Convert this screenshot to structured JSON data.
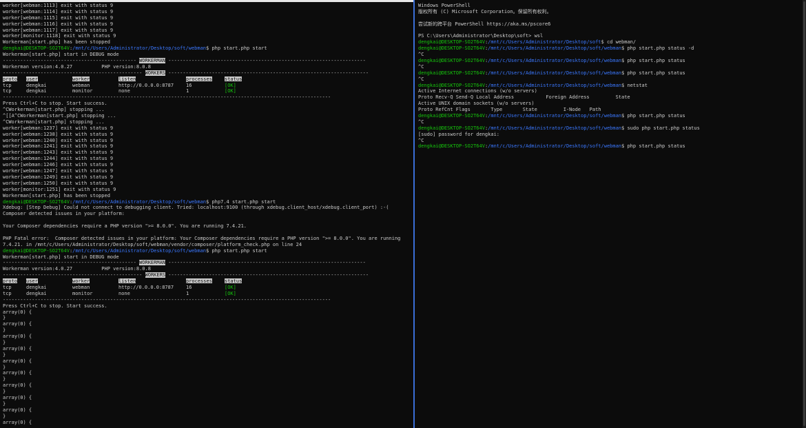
{
  "left": [
    {
      "t": "worker[webman:1113] exit with status 9"
    },
    {
      "t": "worker[webman:1114] exit with status 9"
    },
    {
      "t": "worker[webman:1115] exit with status 9"
    },
    {
      "t": "worker[webman:1116] exit with status 9"
    },
    {
      "t": "worker[webman:1117] exit with status 9"
    },
    {
      "t": "worker[monitor:1118] exit with status 9"
    },
    {
      "t": "Workerman[start.php] has been stopped"
    },
    {
      "prompt": {
        "user": "dengkai@DESKTOP-SO2T64V",
        "path": "/mnt/c/Users/Administrator/Desktop/soft/webman",
        "cmd": "$ php start.php start"
      }
    },
    {
      "t": "Workerman[start.php] start in DEBUG mode"
    },
    {
      "banner": {
        "pre": "---------------------------------------------- ",
        "label": "WORKERMAN",
        "post": " --------------------------------------------------------------------"
      }
    },
    {
      "t": "Workerman version:4.0.27          PHP version:8.0.8"
    },
    {
      "banner": {
        "pre": "------------------------------------------------ ",
        "label": "WORKERS",
        "post": " ---------------------------------------------------------------------"
      }
    },
    {
      "header": [
        "proto",
        "user",
        "worker",
        "listen",
        "processes",
        "status"
      ]
    },
    {
      "row": [
        "tcp",
        "dengkai",
        "webman",
        "http://0.0.0.0:8787",
        "16",
        "[OK]"
      ]
    },
    {
      "row": [
        "tcp",
        "dengkai",
        "monitor",
        "none",
        "1",
        "[OK]"
      ]
    },
    {
      "t": "-----------------------------------------------------------------------------------------------------------------"
    },
    {
      "t": "Press Ctrl+C to stop. Start success."
    },
    {
      "t": "^CWorkerman[start.php] stopping ..."
    },
    {
      "t": "^[[A^CWorkerman[start.php] stopping ..."
    },
    {
      "t": "^CWorkerman[start.php] stopping ..."
    },
    {
      "t": "worker[webman:1237] exit with status 9"
    },
    {
      "t": "worker[webman:1238] exit with status 9"
    },
    {
      "t": "worker[webman:1240] exit with status 9"
    },
    {
      "t": "worker[webman:1241] exit with status 9"
    },
    {
      "t": "worker[webman:1243] exit with status 9"
    },
    {
      "t": "worker[webman:1244] exit with status 9"
    },
    {
      "t": "worker[webman:1246] exit with status 9"
    },
    {
      "t": "worker[webman:1247] exit with status 9"
    },
    {
      "t": "worker[webman:1249] exit with status 9"
    },
    {
      "t": "worker[webman:1250] exit with status 9"
    },
    {
      "t": "worker[monitor:1251] exit with status 9"
    },
    {
      "t": "Workerman[start.php] has been stopped"
    },
    {
      "prompt": {
        "user": "dengkai@DESKTOP-SO2T64V",
        "path": "/mnt/c/Users/Administrator/Desktop/soft/webman",
        "cmd": "$ php7.4 start.php start"
      }
    },
    {
      "t": "Xdebug: [Step Debug] Could not connect to debugging client. Tried: localhost:9100 (through xdebug.client_host/xdebug.client_port) :-("
    },
    {
      "t": "Composer detected issues in your platform:"
    },
    {
      "t": ""
    },
    {
      "t": "Your Composer dependencies require a PHP version \">= 8.0.0\". You are running 7.4.21."
    },
    {
      "t": ""
    },
    {
      "t": "PHP Fatal error:  Composer detected issues in your platform: Your Composer dependencies require a PHP version \">= 8.0.0\". You are running"
    },
    {
      "t": "7.4.21. in /mnt/c/Users/Administrator/Desktop/soft/webman/vendor/composer/platform_check.php on line 24"
    },
    {
      "prompt": {
        "user": "dengkai@DESKTOP-SO2T64V",
        "path": "/mnt/c/Users/Administrator/Desktop/soft/webman",
        "cmd": "$ php start.php start"
      }
    },
    {
      "t": "Workerman[start.php] start in DEBUG mode"
    },
    {
      "banner": {
        "pre": "---------------------------------------------- ",
        "label": "WORKERMAN",
        "post": " --------------------------------------------------------------------"
      }
    },
    {
      "t": "Workerman version:4.0.27          PHP version:8.0.8"
    },
    {
      "banner": {
        "pre": "------------------------------------------------ ",
        "label": "WORKERS",
        "post": " ---------------------------------------------------------------------"
      }
    },
    {
      "header": [
        "proto",
        "user",
        "worker",
        "listen",
        "processes",
        "status"
      ]
    },
    {
      "row": [
        "tcp",
        "dengkai",
        "webman",
        "http://0.0.0.0:8787",
        "16",
        "[OK]"
      ]
    },
    {
      "row": [
        "tcp",
        "dengkai",
        "monitor",
        "none",
        "1",
        "[OK]"
      ]
    },
    {
      "t": "-----------------------------------------------------------------------------------------------------------------"
    },
    {
      "t": "Press Ctrl+C to stop. Start success."
    },
    {
      "t": "array(0) {"
    },
    {
      "t": "}"
    },
    {
      "t": "array(0) {"
    },
    {
      "t": "}"
    },
    {
      "t": "array(0) {"
    },
    {
      "t": "}"
    },
    {
      "t": "array(0) {"
    },
    {
      "t": "}"
    },
    {
      "t": "array(0) {"
    },
    {
      "t": "}"
    },
    {
      "t": "array(0) {"
    },
    {
      "t": "}"
    },
    {
      "t": "array(0) {"
    },
    {
      "t": "}"
    },
    {
      "t": "array(0) {"
    },
    {
      "t": "}"
    },
    {
      "t": "array(0) {"
    },
    {
      "t": "}"
    },
    {
      "t": "array(0) {"
    }
  ],
  "right": [
    {
      "t": "Windows PowerShell"
    },
    {
      "t": "版权所有 (C) Microsoft Corporation。保留所有权利。"
    },
    {
      "t": ""
    },
    {
      "t": "尝试新的跨平台 PowerShell https://aka.ms/pscore6"
    },
    {
      "t": ""
    },
    {
      "t": "PS C:\\Users\\Administrator\\Desktop\\soft> wsl"
    },
    {
      "prompt": {
        "user": "dengkai@DESKTOP-SO2T64V",
        "path": "/mnt/c/Users/Administrator/Desktop/soft",
        "cmd": "$ cd webman/"
      }
    },
    {
      "prompt": {
        "user": "dengkai@DESKTOP-SO2T64V",
        "path": "/mnt/c/Users/Administrator/Desktop/soft/webman",
        "cmd": "$ php start.php status -d"
      }
    },
    {
      "t": "^C"
    },
    {
      "prompt": {
        "user": "dengkai@DESKTOP-SO2T64V",
        "path": "/mnt/c/Users/Administrator/Desktop/soft/webman",
        "cmd": "$ php start.php status"
      }
    },
    {
      "t": "^C"
    },
    {
      "prompt": {
        "user": "dengkai@DESKTOP-SO2T64V",
        "path": "/mnt/c/Users/Administrator/Desktop/soft/webman",
        "cmd": "$ php start.php status"
      }
    },
    {
      "t": "^C"
    },
    {
      "prompt": {
        "user": "dengkai@DESKTOP-SO2T64V",
        "path": "/mnt/c/Users/Administrator/Desktop/soft/webman",
        "cmd": "$ netstat"
      }
    },
    {
      "t": "Active Internet connections (w/o servers)"
    },
    {
      "t": "Proto Recv-Q Send-Q Local Address           Foreign Address         State"
    },
    {
      "t": "Active UNIX domain sockets (w/o servers)"
    },
    {
      "t": "Proto RefCnt Flags       Type       State         I-Node   Path"
    },
    {
      "prompt": {
        "user": "dengkai@DESKTOP-SO2T64V",
        "path": "/mnt/c/Users/Administrator/Desktop/soft/webman",
        "cmd": "$ php start.php status"
      }
    },
    {
      "t": "^C"
    },
    {
      "prompt": {
        "user": "dengkai@DESKTOP-SO2T64V",
        "path": "/mnt/c/Users/Administrator/Desktop/soft/webman",
        "cmd": "$ sudo php start.php status"
      }
    },
    {
      "t": "[sudo] password for dengkai:"
    },
    {
      "t": "^C"
    },
    {
      "prompt": {
        "user": "dengkai@DESKTOP-SO2T64V",
        "path": "/mnt/c/Users/Administrator/Desktop/soft/webman",
        "cmd": "$ php start.php status"
      }
    }
  ]
}
